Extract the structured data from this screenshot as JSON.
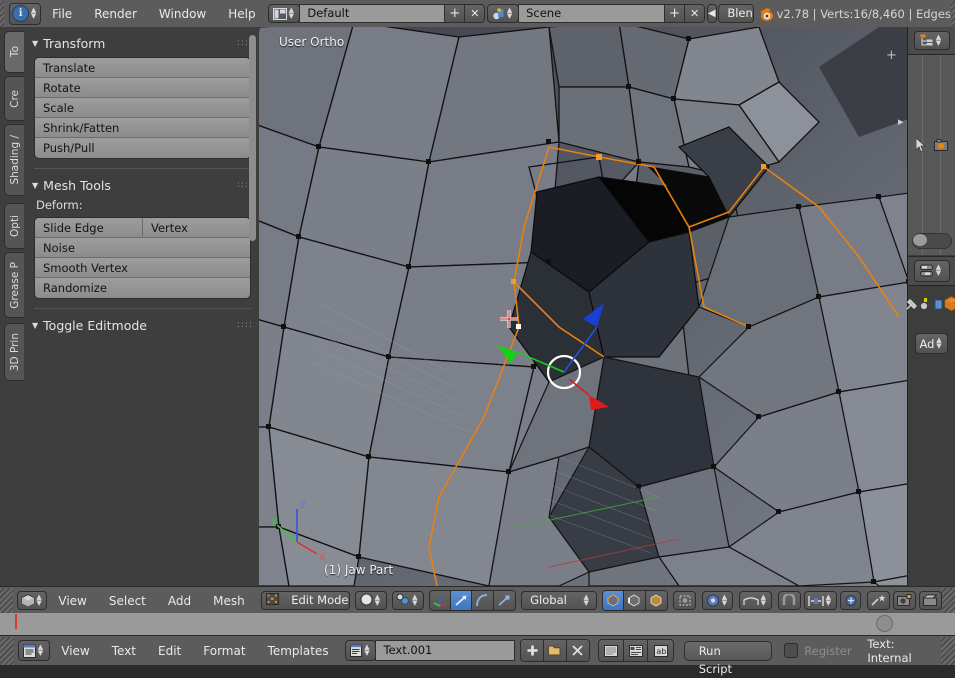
{
  "app": {
    "title": "Blender",
    "version_stats": "v2.78 | Verts:16/8,460 | Edges",
    "accent": "#4074bd",
    "orange": "#e87d0d"
  },
  "topbar": {
    "editor_icon": "info-editor-icon",
    "menus": [
      "File",
      "Render",
      "Window",
      "Help"
    ],
    "screen": {
      "icon": "screen-layout-icon",
      "value": "Default",
      "add_label": "+",
      "remove_label": "✕"
    },
    "scene": {
      "icon": "scene-icon",
      "value": "Scene",
      "add_label": "+",
      "remove_label": "✕"
    },
    "engine": {
      "icon": "collapse-left-icon",
      "value": "Blender Render"
    },
    "stats": "v2.78 | Verts:16/8,460 | Edges"
  },
  "toolshelf": {
    "tabs": [
      {
        "label": "To",
        "active": true
      },
      {
        "label": "Cre",
        "active": false
      },
      {
        "label": "Shading /",
        "active": false
      },
      {
        "label": "Opti",
        "active": false
      },
      {
        "label": "Grease P",
        "active": false
      },
      {
        "label": "3D Prin",
        "active": false
      }
    ],
    "panels": [
      {
        "name": "transform-panel",
        "title": "Transform",
        "open": true,
        "buttons": [
          "Translate",
          "Rotate",
          "Scale",
          "Shrink/Fatten",
          "Push/Pull"
        ]
      },
      {
        "name": "mesh-tools-panel",
        "title": "Mesh Tools",
        "open": true,
        "sublabel": "Deform:",
        "row": [
          "Slide Edge",
          "Vertex"
        ],
        "buttons": [
          "Noise",
          "Smooth Vertex",
          "Randomize"
        ]
      },
      {
        "name": "toggle-editmode-panel",
        "title": "Toggle Editmode",
        "open": true
      }
    ]
  },
  "viewport": {
    "view_label": "User Ortho",
    "object_label": "(1) Jaw Part",
    "axis_gizmo": {
      "x": "x",
      "y": "y",
      "z": "z"
    },
    "manipulator": "translate-manipulator",
    "cursor": "crosshair-3d-cursor"
  },
  "properties_strip": {
    "header_icon": "outliner-icon",
    "cursor_icon": "mouse-pointer-icon",
    "render_icon": "render-camera-icon",
    "header2_icon": "properties-editor-icon",
    "icons": [
      "pin-icon",
      "material-icon",
      "object-data-icon",
      "object-icon"
    ],
    "add_label": "Ad"
  },
  "view3d_header": {
    "editor_icon": "3d-view-editor-icon",
    "menus": [
      "View",
      "Select",
      "Add",
      "Mesh"
    ],
    "mode": {
      "icon": "edit-mode-icon",
      "value": "Edit Mode"
    },
    "shading": {
      "icon": "solid-shading-icon"
    },
    "select_mode": {
      "icon": "vertex-select-icon"
    },
    "manipulator_toggles": [
      {
        "name": "manipulator-icon",
        "on": false
      },
      {
        "name": "translate-manipulator-icon",
        "on": true
      },
      {
        "name": "rotate-manipulator-icon",
        "on": false
      },
      {
        "name": "scale-manipulator-icon",
        "on": false
      }
    ],
    "orientation": {
      "value": "Global"
    },
    "mesh_select_modes": [
      {
        "name": "vertex-select-mode-icon",
        "on": true
      },
      {
        "name": "edge-select-mode-icon",
        "on": false
      },
      {
        "name": "face-select-mode-icon",
        "on": false
      }
    ],
    "occlude": {
      "name": "limit-selection-visible-icon",
      "on": false
    },
    "pivot": {
      "name": "pivot-median-point-icon"
    },
    "proportional": {
      "name": "proportional-edit-off-icon"
    },
    "snap": {
      "name": "magnet-snap-icon"
    },
    "snap_target": {
      "name": "snap-increment-icon"
    },
    "snap_mode": {
      "name": "snap-closest-icon"
    },
    "quick_effects": {
      "name": "quick-effects-icon"
    },
    "render_view": {
      "name": "render-opengl-image-icon"
    },
    "render_anim": {
      "name": "render-opengl-animation-icon"
    }
  },
  "text_editor": {
    "editor_icon": "text-editor-icon",
    "menus": [
      "View",
      "Text",
      "Edit",
      "Format",
      "Templates"
    ],
    "datablock": {
      "icon": "text-datablock-icon",
      "value": "Text.001"
    },
    "new_label": "+",
    "open_icon": "open-file-icon",
    "unlink_icon": "unlink-icon",
    "toggles": [
      {
        "name": "line-numbers-icon",
        "on": false
      },
      {
        "name": "word-wrap-icon",
        "on": false
      },
      {
        "name": "syntax-highlight-icon",
        "on": false
      }
    ],
    "run_script_label": "Run Script",
    "register_label": "Register",
    "register_checked": false,
    "status": "Text: Internal"
  }
}
